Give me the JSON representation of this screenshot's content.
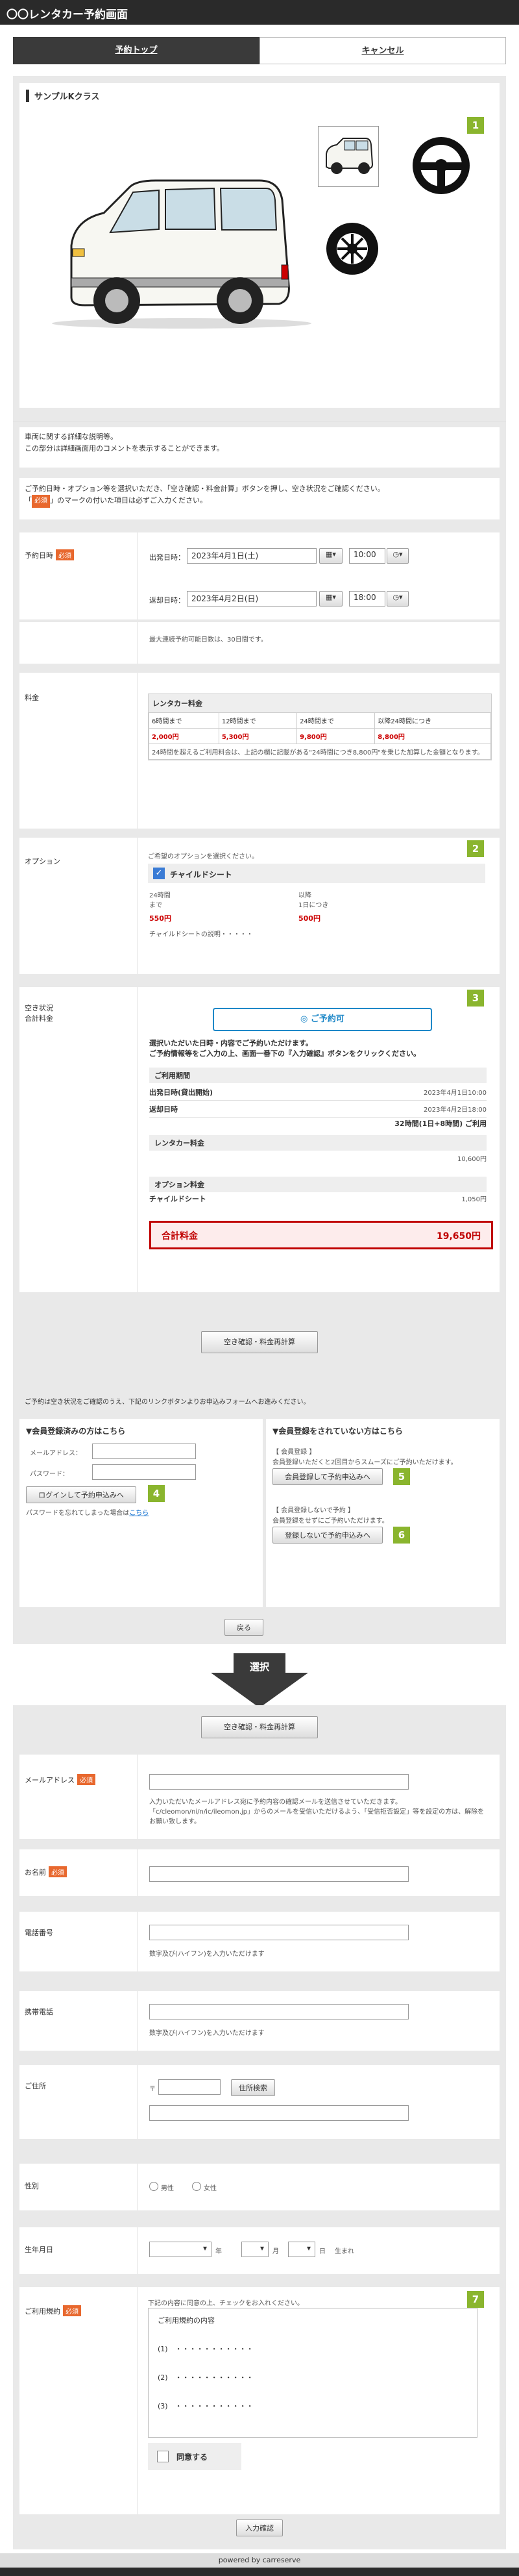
{
  "header": {
    "title": "〇〇レンタカー予約画面"
  },
  "tabs": [
    {
      "label": "予約トップ"
    },
    {
      "label": "キャンセル"
    }
  ],
  "vehicle": {
    "class_title": "サンプルKクラス",
    "description": "車両に関する詳細な説明等。\nこの部分は詳細画面用のコメントを表示することができます。"
  },
  "notice": {
    "line1": "ご予約日時・オプション等を選択いただき、「空き確認・料金計算」ボタンを押し、空き状況をご確認ください。",
    "line2_pre": "「",
    "line2_tag": "必須",
    "line2_post": "」のマークの付いた項目は必ずご入力ください。"
  },
  "datetime": {
    "label": "予約日時",
    "required": "必須",
    "depart_label": "出発日時：",
    "depart_date": "2023年4月1日(土)",
    "depart_time": "10:00",
    "return_label": "返却日時：",
    "return_date": "2023年4月2日(日)",
    "return_time": "18:00",
    "max_note": "最大連続予約可能日数は、30日間です。"
  },
  "fee": {
    "label": "料金",
    "table_title": "レンタカー料金",
    "headers": [
      "6時間まで",
      "12時間まで",
      "24時間まで",
      "以降24時間につき"
    ],
    "prices": [
      "2,000円",
      "5,300円",
      "9,800円",
      "8,800円"
    ],
    "note": "24時間を超えるご利用料金は、上記の欄に記載がある\"24時間につき8,800円\"を乗じた加算した金額となります。"
  },
  "options": {
    "label": "オプション",
    "intro": "ご希望のオプションを選択ください。",
    "item_name": "チャイルドシート",
    "col1_head": "24時間\nまで",
    "col2_head": "以降\n1日につき",
    "col1_price": "550円",
    "col2_price": "500円",
    "desc": "チャイルドシートの説明・・・・・"
  },
  "availability": {
    "label": "空き状況\n合計料金",
    "status_button": "ご予約可",
    "msg1": "選択いただいた日時・内容でご予約いただけます。",
    "msg2": "ご予約情報等をご入力の上、画面一番下の『入力確認』ボタンをクリックください。",
    "period_title": "ご利用期間",
    "depart_label": "出発日時(貸出開始)",
    "depart_value": "2023年4月1日10:00",
    "return_label": "返却日時",
    "return_value": "2023年4月2日18:00",
    "duration": "32時間(1日+8時間) ご利用",
    "rental_title": "レンタカー料金",
    "rental_value": "10,600円",
    "option_title": "オプション料金",
    "option_name": "チャイルドシート",
    "option_value": "1,050円",
    "total_label": "合計料金",
    "total_value": "19,650円"
  },
  "calc_button": "空き確認・料金再計算",
  "login_notice": "ご予約は空き状況をご確認のうえ、下記のリンクボタンよりお申込みフォームへお進みください。",
  "member": {
    "title": "▼会員登録済みの方はこちら",
    "email_label": "メールアドレス：",
    "password_label": "パスワード：",
    "login_button": "ログインして予約申込みへ",
    "forgot_pre": "パスワードを忘れてしまった場合は",
    "forgot_link": "こちら"
  },
  "nonmember": {
    "title": "▼会員登録をされていない方はこちら",
    "reg_title": "【 会員登録 】",
    "reg_desc": "会員登録いただくと2回目からスムーズにご予約いただけます。",
    "reg_button": "会員登録して予約申込みへ",
    "noreg_title": "【 会員登録しないで予約 】",
    "noreg_desc": "会員登録をせずにご予約いただけます。",
    "noreg_button": "登録しないで予約申込みへ"
  },
  "back_button": "戻る",
  "select_label": "選択",
  "form": {
    "calc_button": "空き確認・料金再計算",
    "email_label": "メールアドレス",
    "email_note": "入力いただいたメールアドレス宛に予約内容の確認メールを送信させていただきます。\n「c/cleomon/ni/n/ic/ileomon.jp」からのメールを受信いただけるよう、「受信拒否設定」等を設定の方は、解除をお願い致します。",
    "name_label": "お名前",
    "phone_label": "電話番号",
    "phone_note": "数字及び(ハイフン)を入力いただけます",
    "mobile_label": "携帯電話",
    "mobile_note": "数字及び(ハイフン)を入力いただけます",
    "address_label": "ご住所",
    "zip_mark": "〒",
    "zip_button": "住所検索",
    "gender_label": "性別",
    "male": "男性",
    "female": "女性",
    "birth_label": "生年月日",
    "year": "年",
    "month": "月",
    "day": "日",
    "born": "生まれ",
    "terms_label": "ご利用規約",
    "terms_intro": "下記の内容に同意の上、チェックをお入れください。",
    "terms_title": "ご利用規約の内容",
    "terms_1": "(1)　・・・・・・・・・・・",
    "terms_2": "(2)　・・・・・・・・・・・",
    "terms_3": "(3)　・・・・・・・・・・・",
    "agree": "同意する",
    "confirm_button": "入力確認",
    "required": "必須"
  },
  "badges": [
    "1",
    "2",
    "3",
    "4",
    "5",
    "6",
    "7"
  ],
  "footer": "powered by carreserve",
  "colors": {
    "accent": "#8ab52e",
    "required": "#e8682e",
    "status": "#1e88c8",
    "total": "#c00000"
  }
}
